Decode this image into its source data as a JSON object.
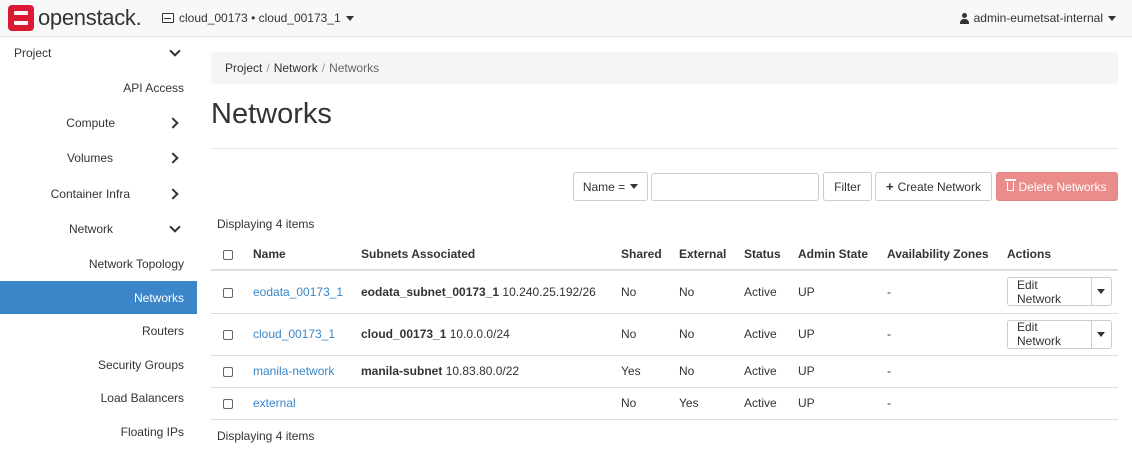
{
  "brand": {
    "name": "openstack."
  },
  "project_switcher": {
    "label": "cloud_00173 • cloud_00173_1"
  },
  "user_menu": {
    "label": "admin-eumetsat-internal"
  },
  "sidebar": {
    "items": [
      {
        "label": "Project"
      },
      {
        "label": "API Access"
      },
      {
        "label": "Compute"
      },
      {
        "label": "Volumes"
      },
      {
        "label": "Container Infra"
      },
      {
        "label": "Network"
      },
      {
        "label": "Network Topology"
      },
      {
        "label": "Networks"
      },
      {
        "label": "Routers"
      },
      {
        "label": "Security Groups"
      },
      {
        "label": "Load Balancers"
      },
      {
        "label": "Floating IPs"
      }
    ],
    "active": "Networks"
  },
  "breadcrumb": {
    "items": [
      "Project",
      "Network",
      "Networks"
    ]
  },
  "page": {
    "title": "Networks"
  },
  "toolbar": {
    "filter_field": "Name =",
    "filter_value": "",
    "filter_button": "Filter",
    "create_button": "Create Network",
    "delete_button": "Delete Networks"
  },
  "table": {
    "count_top": "Displaying 4 items",
    "count_bottom": "Displaying 4 items",
    "headers": [
      "Name",
      "Subnets Associated",
      "Shared",
      "External",
      "Status",
      "Admin State",
      "Availability Zones",
      "Actions"
    ],
    "rows": [
      {
        "name": "eodata_00173_1",
        "subnet_name": "eodata_subnet_00173_1",
        "subnet_cidr": "10.240.25.192/26",
        "shared": "No",
        "external": "No",
        "status": "Active",
        "admin_state": "UP",
        "zones": "-",
        "action": "Edit Network"
      },
      {
        "name": "cloud_00173_1",
        "subnet_name": "cloud_00173_1",
        "subnet_cidr": "10.0.0.0/24",
        "shared": "No",
        "external": "No",
        "status": "Active",
        "admin_state": "UP",
        "zones": "-",
        "action": "Edit Network"
      },
      {
        "name": "manila-network",
        "subnet_name": "manila-subnet",
        "subnet_cidr": "10.83.80.0/22",
        "shared": "Yes",
        "external": "No",
        "status": "Active",
        "admin_state": "UP",
        "zones": "-",
        "action": ""
      },
      {
        "name": "external",
        "subnet_name": "",
        "subnet_cidr": "",
        "shared": "No",
        "external": "Yes",
        "status": "Active",
        "admin_state": "UP",
        "zones": "-",
        "action": ""
      }
    ]
  }
}
